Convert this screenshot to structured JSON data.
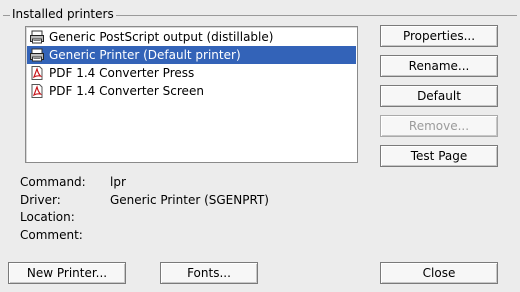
{
  "installed_printers": {
    "legend": "Installed printers",
    "printers": [
      {
        "label": "Generic PostScript output (distillable)",
        "icon": "printer-icon",
        "selected": false
      },
      {
        "label": "Generic Printer (Default printer)",
        "icon": "printer-icon",
        "selected": true
      },
      {
        "label": "PDF 1.4 Converter Press",
        "icon": "pdf-icon",
        "selected": false
      },
      {
        "label": "PDF 1.4 Converter Screen",
        "icon": "pdf-icon",
        "selected": false
      }
    ]
  },
  "side_buttons": {
    "properties": "Properties...",
    "rename": "Rename...",
    "default": "Default",
    "remove": "Remove...",
    "test_page": "Test Page"
  },
  "info": {
    "command_label": "Command:",
    "command_value": "lpr",
    "driver_label": "Driver:",
    "driver_value": "Generic Printer (SGENPRT)",
    "location_label": "Location:",
    "location_value": "",
    "comment_label": "Comment:",
    "comment_value": ""
  },
  "footer": {
    "new_printer": "New Printer...",
    "fonts": "Fonts...",
    "close": "Close"
  },
  "colors": {
    "selection": "#3363b8",
    "disabled_text": "#9b9b9b"
  }
}
